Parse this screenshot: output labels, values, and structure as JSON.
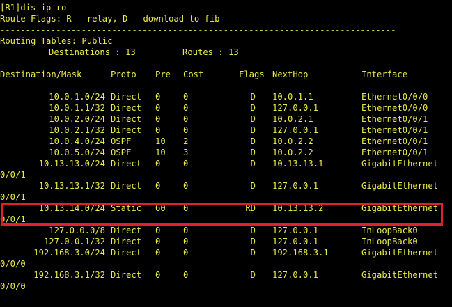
{
  "terminal": {
    "command_line": "[R1]dis ip ro",
    "route_flags": "Route Flags: R - relay, D - download to fib",
    "separator": "------------------------------------------------------------------------------",
    "routing_tables": "Routing Tables: Public",
    "destinations_label": "Destinations : 13",
    "routes_label": "Routes : 13",
    "headers": {
      "destination": "Destination/Mask",
      "proto": "Proto",
      "pre": "Pre",
      "cost": "Cost",
      "flags": "Flags",
      "nexthop": "NextHop",
      "interface": "Interface"
    },
    "routes": [
      {
        "dest": "10.0.1.0/24",
        "proto": "Direct",
        "pre": "0",
        "cost": "0",
        "flags": "D",
        "nexthop": "10.0.1.1",
        "iface": "Ethernet0/0/0",
        "wrap": ""
      },
      {
        "dest": "10.0.1.1/32",
        "proto": "Direct",
        "pre": "0",
        "cost": "0",
        "flags": "D",
        "nexthop": "127.0.0.1",
        "iface": "Ethernet0/0/0",
        "wrap": ""
      },
      {
        "dest": "10.0.2.0/24",
        "proto": "Direct",
        "pre": "0",
        "cost": "0",
        "flags": "D",
        "nexthop": "10.0.2.1",
        "iface": "Ethernet0/0/1",
        "wrap": ""
      },
      {
        "dest": "10.0.2.1/32",
        "proto": "Direct",
        "pre": "0",
        "cost": "0",
        "flags": "D",
        "nexthop": "127.0.0.1",
        "iface": "Ethernet0/0/1",
        "wrap": ""
      },
      {
        "dest": "10.0.4.0/24",
        "proto": "OSPF",
        "pre": "10",
        "cost": "2",
        "flags": "D",
        "nexthop": "10.0.2.2",
        "iface": "Ethernet0/0/1",
        "wrap": ""
      },
      {
        "dest": "10.0.5.0/24",
        "proto": "OSPF",
        "pre": "10",
        "cost": "3",
        "flags": "D",
        "nexthop": "10.0.2.2",
        "iface": "Ethernet0/0/1",
        "wrap": ""
      },
      {
        "dest": "10.13.13.0/24",
        "proto": "Direct",
        "pre": "0",
        "cost": "0",
        "flags": "D",
        "nexthop": "10.13.13.1",
        "iface": "GigabitEthernet",
        "wrap": "0/0/1"
      },
      {
        "dest": "10.13.13.1/32",
        "proto": "Direct",
        "pre": "0",
        "cost": "0",
        "flags": "D",
        "nexthop": "127.0.0.1",
        "iface": "GigabitEthernet",
        "wrap": "0/0/1"
      },
      {
        "dest": "10.13.14.0/24",
        "proto": "Static",
        "pre": "60",
        "cost": "0",
        "flags": "RD",
        "nexthop": "10.13.13.2",
        "iface": "GigabitEthernet",
        "wrap": "0/0/1"
      },
      {
        "dest": "127.0.0.0/8",
        "proto": "Direct",
        "pre": "0",
        "cost": "0",
        "flags": "D",
        "nexthop": "127.0.0.1",
        "iface": "InLoopBack0",
        "wrap": ""
      },
      {
        "dest": "127.0.0.1/32",
        "proto": "Direct",
        "pre": "0",
        "cost": "0",
        "flags": "D",
        "nexthop": "127.0.0.1",
        "iface": "InLoopBack0",
        "wrap": ""
      },
      {
        "dest": "192.168.3.0/24",
        "proto": "Direct",
        "pre": "0",
        "cost": "0",
        "flags": "D",
        "nexthop": "192.168.3.1",
        "iface": "GigabitEthernet",
        "wrap": "0/0/0"
      },
      {
        "dest": "192.168.3.1/32",
        "proto": "Direct",
        "pre": "0",
        "cost": "0",
        "flags": "D",
        "nexthop": "127.0.0.1",
        "iface": "GigabitEthernet",
        "wrap": "0/0/0"
      }
    ],
    "highlighted_route": "10.13.14.0/24",
    "colors": {
      "background": "#000000",
      "text": "#e8e84a",
      "highlight": "#e0202a"
    }
  }
}
